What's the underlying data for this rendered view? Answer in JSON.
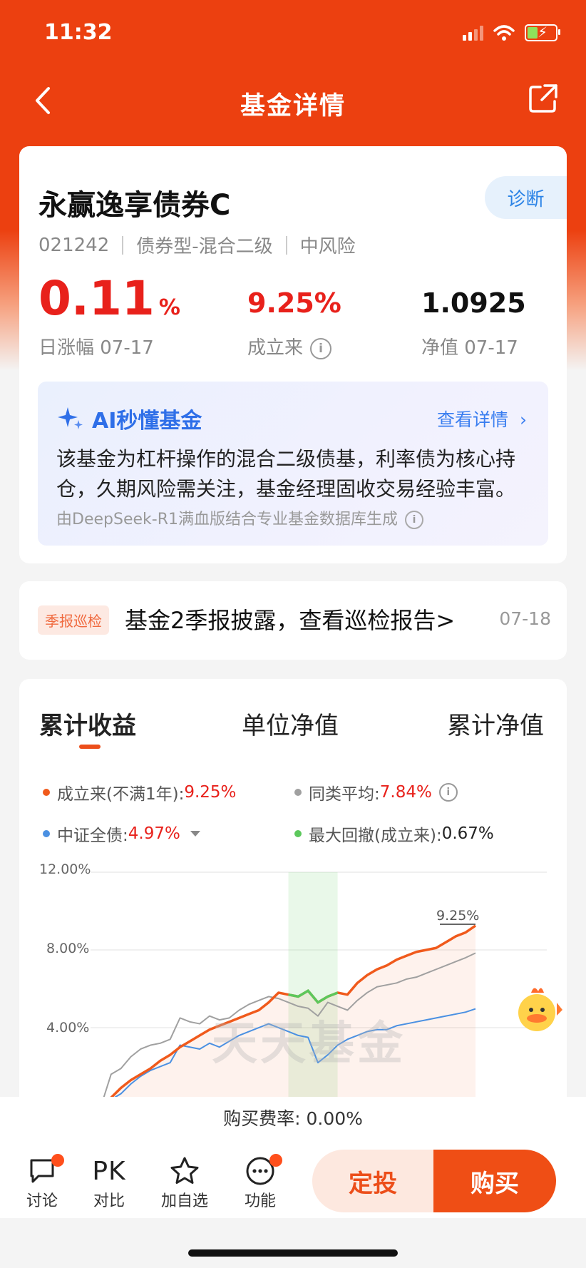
{
  "status": {
    "time": "11:32"
  },
  "nav": {
    "title": "基金详情"
  },
  "fund": {
    "name": "永赢逸享债券C",
    "diagnose": "诊断",
    "code": "021242",
    "type": "债券型-混合二级",
    "risk": "中风险",
    "daily_change": "0.11",
    "daily_change_unit": "%",
    "daily_label": "日涨幅 07-17",
    "since_inception": "9.25%",
    "since_label": "成立来",
    "nav_value": "1.0925",
    "nav_label": "净值 07-17"
  },
  "ai": {
    "title": "AI秒懂基金",
    "more": "查看详情",
    "summary": "该基金为杠杆操作的混合二级债基，利率债为核心持仓，久期风险需关注，基金经理固收交易经验丰富。",
    "footnote": "由DeepSeek-R1满血版结合专业基金数据库生成"
  },
  "report": {
    "tag": "季报巡检",
    "text": "基金2季报披露，查看巡检报告>",
    "date": "07-18"
  },
  "chart": {
    "tabs": [
      "累计收益",
      "单位净值",
      "累计净值"
    ],
    "legend": {
      "fund_label": "成立来(不满1年):",
      "fund_value": "9.25%",
      "avg_label": "同类平均:",
      "avg_value": "7.84%",
      "index_label": "中证全债:",
      "index_value": "4.97%",
      "dd_label": "最大回撤(成立来):",
      "dd_value": "0.67%"
    },
    "yticks": [
      "12.00%",
      "8.00%",
      "4.00%"
    ],
    "end_label": "9.25%",
    "watermark": "天天基金",
    "colors": {
      "fund": "#f05a1c",
      "average": "#a0a0a0",
      "index": "#4a90e2",
      "drawdown": "#5cc85c"
    }
  },
  "chart_data": {
    "type": "line",
    "ylim": [
      0,
      12
    ],
    "yticks": [
      "12.00%",
      "8.00%",
      "4.00%"
    ],
    "series": [
      {
        "name": "成立来(不满1年)",
        "values": [
          0.0,
          0.4,
          0.9,
          1.3,
          1.6,
          1.9,
          2.3,
          2.6,
          3.0,
          3.3,
          3.6,
          3.9,
          4.1,
          4.3,
          4.5,
          4.7,
          4.9,
          5.3,
          5.8,
          5.7,
          5.6,
          5.9,
          5.3,
          5.6,
          5.8,
          5.7,
          6.3,
          6.7,
          7.0,
          7.2,
          7.5,
          7.7,
          7.9,
          8.0,
          8.1,
          8.4,
          8.7,
          8.9,
          9.25
        ]
      },
      {
        "name": "同类平均",
        "values": [
          0.0,
          1.6,
          1.9,
          2.5,
          2.9,
          3.1,
          3.2,
          3.4,
          4.5,
          4.3,
          4.2,
          4.6,
          4.4,
          4.5,
          4.9,
          5.2,
          5.4,
          5.6,
          5.5,
          5.3,
          5.1,
          5.0,
          4.6,
          5.3,
          5.1,
          4.9,
          5.4,
          5.8,
          6.1,
          6.2,
          6.3,
          6.5,
          6.6,
          6.8,
          7.0,
          7.2,
          7.4,
          7.6,
          7.84
        ]
      },
      {
        "name": "中证全债",
        "values": [
          0.0,
          0.3,
          0.6,
          1.1,
          1.5,
          1.8,
          2.0,
          2.2,
          3.1,
          3.0,
          2.9,
          3.2,
          3.0,
          3.3,
          3.6,
          3.8,
          4.0,
          4.2,
          4.0,
          3.8,
          3.6,
          3.5,
          2.2,
          2.6,
          3.1,
          3.4,
          3.6,
          3.8,
          3.9,
          3.9,
          4.1,
          4.2,
          4.3,
          4.4,
          4.5,
          4.6,
          4.7,
          4.8,
          4.97
        ]
      }
    ],
    "drawdown_range": [
      19,
      24
    ]
  },
  "fee": {
    "label": "购买费率: 0.00%"
  },
  "bottom": {
    "discuss": "讨论",
    "pk_icon": "PK",
    "compare": "对比",
    "watch": "加自选",
    "functions": "功能",
    "sip": "定投",
    "buy": "购买"
  }
}
